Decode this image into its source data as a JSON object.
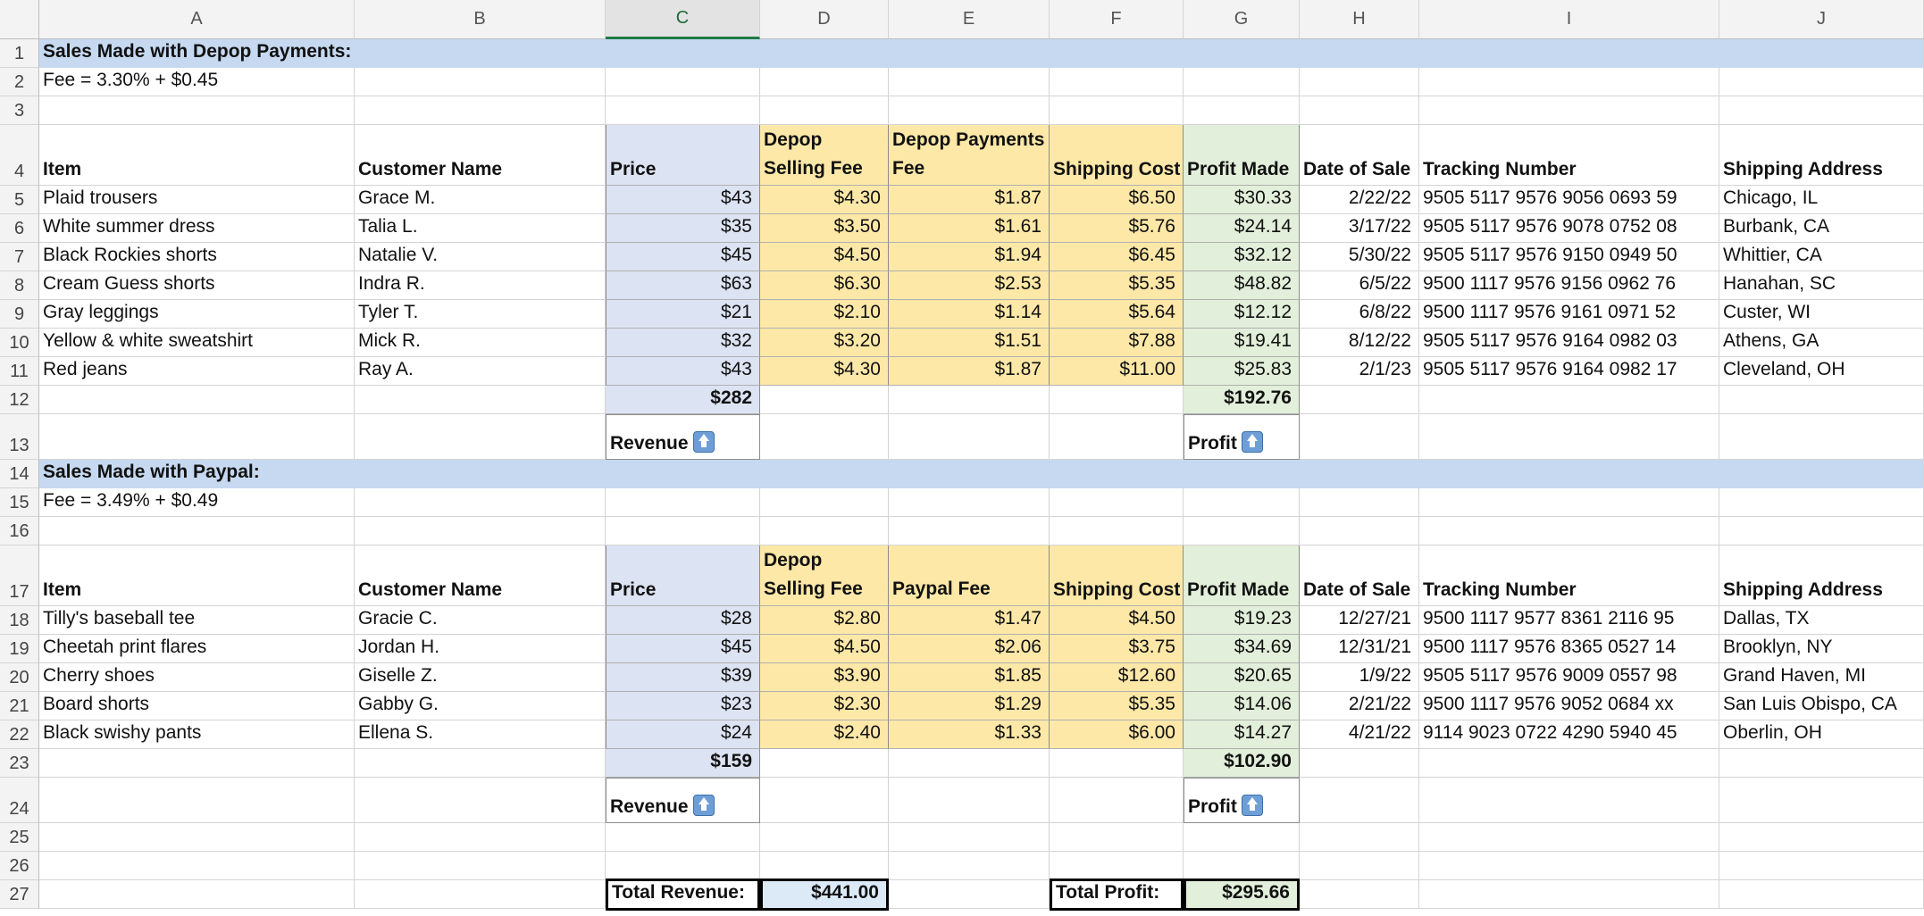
{
  "column_headers": [
    "A",
    "B",
    "C",
    "D",
    "E",
    "F",
    "G",
    "H",
    "I",
    "J"
  ],
  "selected_column": "C",
  "row_numbers": [
    "1",
    "2",
    "3",
    "4",
    "5",
    "6",
    "7",
    "8",
    "9",
    "10",
    "11",
    "12",
    "13",
    "14",
    "15",
    "16",
    "17",
    "18",
    "19",
    "20",
    "21",
    "22",
    "23",
    "24",
    "25",
    "26",
    "27"
  ],
  "section1": {
    "title": "Sales Made with Depop Payments:",
    "fee_note": "Fee = 3.30% + $0.45",
    "headers": [
      "Item",
      "Customer Name",
      "Price",
      "Depop Selling Fee",
      "Depop Payments Fee",
      "Shipping Cost",
      "Profit Made",
      "Date of Sale",
      "Tracking Number",
      "Shipping Address"
    ],
    "rows": [
      [
        "Plaid trousers",
        "Grace M.",
        "$43",
        "$4.30",
        "$1.87",
        "$6.50",
        "$30.33",
        "2/22/22",
        "9505 5117 9576 9056 0693 59",
        "Chicago, IL"
      ],
      [
        "White summer dress",
        "Talia L.",
        "$35",
        "$3.50",
        "$1.61",
        "$5.76",
        "$24.14",
        "3/17/22",
        "9505 5117 9576 9078 0752 08",
        "Burbank, CA"
      ],
      [
        "Black Rockies shorts",
        "Natalie V.",
        "$45",
        "$4.50",
        "$1.94",
        "$6.45",
        "$32.12",
        "5/30/22",
        "9505 5117 9576 9150 0949 50",
        "Whittier, CA"
      ],
      [
        "Cream Guess shorts",
        "Indra R.",
        "$63",
        "$6.30",
        "$2.53",
        "$5.35",
        "$48.82",
        "6/5/22",
        "9500 1117 9576 9156 0962 76",
        "Hanahan, SC"
      ],
      [
        "Gray leggings",
        "Tyler T.",
        "$21",
        "$2.10",
        "$1.14",
        "$5.64",
        "$12.12",
        "6/8/22",
        "9500 1117 9576 9161 0971 52",
        "Custer, WI"
      ],
      [
        "Yellow & white sweatshirt",
        "Mick R.",
        "$32",
        "$3.20",
        "$1.51",
        "$7.88",
        "$19.41",
        "8/12/22",
        "9505 5117 9576 9164 0982 03",
        "Athens, GA"
      ],
      [
        "Red jeans",
        "Ray A.",
        "$43",
        "$4.30",
        "$1.87",
        "$11.00",
        "$25.83",
        "2/1/23",
        "9505 5117 9576 9164 0982 17",
        "Cleveland, OH"
      ]
    ],
    "revenue_total": "$282",
    "profit_total": "$192.76",
    "revenue_label": "Revenue",
    "profit_label": "Profit"
  },
  "section2": {
    "title": "Sales Made with Paypal:",
    "fee_note": "Fee = 3.49% + $0.49",
    "headers": [
      "Item",
      "Customer Name",
      "Price",
      "Depop Selling Fee",
      "Paypal Fee",
      "Shipping Cost",
      "Profit Made",
      "Date of Sale",
      "Tracking Number",
      "Shipping Address"
    ],
    "rows": [
      [
        "Tilly's baseball tee",
        "Gracie C.",
        "$28",
        "$2.80",
        "$1.47",
        "$4.50",
        "$19.23",
        "12/27/21",
        "9500 1117 9577 8361 2116 95",
        "Dallas, TX"
      ],
      [
        "Cheetah print flares",
        "Jordan H.",
        "$45",
        "$4.50",
        "$2.06",
        "$3.75",
        "$34.69",
        "12/31/21",
        "9500 1117 9576 8365 0527 14",
        "Brooklyn, NY"
      ],
      [
        "Cherry shoes",
        "Giselle Z.",
        "$39",
        "$3.90",
        "$1.85",
        "$12.60",
        "$20.65",
        "1/9/22",
        "9505 5117 9576 9009 0557 98",
        "Grand Haven, MI"
      ],
      [
        "Board shorts",
        "Gabby G.",
        "$23",
        "$2.30",
        "$1.29",
        "$5.35",
        "$14.06",
        "2/21/22",
        "9500 1117 9576 9052 0684 xx",
        "San Luis Obispo, CA"
      ],
      [
        "Black swishy pants",
        "Ellena S.",
        "$24",
        "$2.40",
        "$1.33",
        "$6.00",
        "$14.27",
        "4/21/22",
        "9114 9023 0722 4290 5940 45",
        "Oberlin, OH"
      ]
    ],
    "revenue_total": "$159",
    "profit_total": "$102.90",
    "revenue_label": "Revenue",
    "profit_label": "Profit"
  },
  "totals": {
    "revenue_label": "Total Revenue:",
    "revenue_value": "$441.00",
    "profit_label": "Total Profit:",
    "profit_value": "$295.66"
  },
  "icons": {
    "revenue_arrow": "up-arrow-icon",
    "profit_arrow": "up-arrow-icon"
  },
  "colors": {
    "section_band": "#c6d9f0",
    "price_column": "#dce3f2",
    "fee_columns": "#fde8a8",
    "profit_column": "#e2efda",
    "selected_header_accent": "#1e7b45"
  }
}
